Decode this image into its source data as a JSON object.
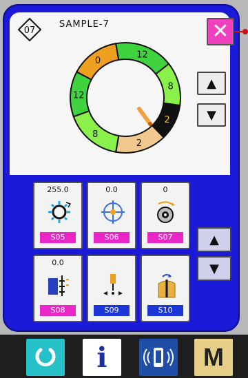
{
  "pattern": {
    "number": "07",
    "name": "SAMPLE-7"
  },
  "close_button": {
    "label": "✕"
  },
  "dial": {
    "segments": [
      {
        "label": "0",
        "color": "#f0a020"
      },
      {
        "label": "12",
        "color": "#3fd43f"
      },
      {
        "label": "8",
        "color": "#8af04a"
      },
      {
        "label": "2",
        "color": "#111111"
      },
      {
        "label": "2",
        "color": "#f0c890"
      },
      {
        "label": "8",
        "color": "#8af04a"
      },
      {
        "label": "12",
        "color": "#3fd43f"
      }
    ]
  },
  "tiles": [
    {
      "value": "255.0",
      "code": "S05",
      "icon": "tension-dial-icon"
    },
    {
      "value": "0.0",
      "code": "S06",
      "icon": "crosshair-target-icon"
    },
    {
      "value": "0",
      "code": "S07",
      "icon": "thread-spool-icon"
    },
    {
      "value": "0.0",
      "code": "S08",
      "icon": "feed-adjust-icon"
    },
    {
      "value": "",
      "code": "S09",
      "icon": "needle-position-icon"
    },
    {
      "value": "",
      "code": "S10",
      "icon": "presser-foot-icon"
    }
  ],
  "nav": [
    {
      "icon": "reset-icon",
      "label": ""
    },
    {
      "icon": "info-icon",
      "label": "i"
    },
    {
      "icon": "communication-icon",
      "label": ""
    },
    {
      "icon": "mode-icon",
      "label": "M"
    }
  ],
  "colors": {
    "frame": "#1a1ad8",
    "close": "#f03fbf",
    "code_magenta": "#ea27c6",
    "code_blue": "#1a35d8"
  }
}
